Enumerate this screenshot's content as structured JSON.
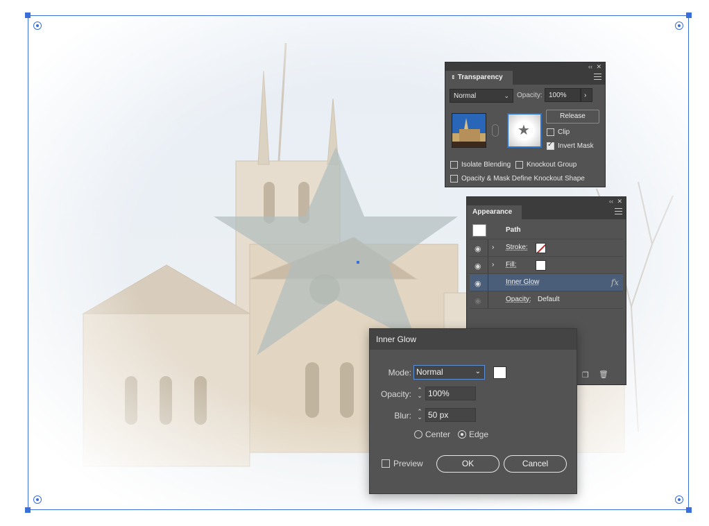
{
  "app": "Adobe Illustrator",
  "colors": {
    "selection": "#3a6ed8",
    "panel_bg": "#535353",
    "panel_header": "#3c3c3c",
    "accent": "#2f74c9",
    "selected_row": "#4a5e7a",
    "star_fill": "#8ec2ec"
  },
  "transparency": {
    "tab": "Transparency",
    "blend_mode": "Normal",
    "opacity_label": "Opacity:",
    "opacity_value": "100%",
    "release_label": "Release",
    "clip_label": "Clip",
    "clip_checked": false,
    "invert_mask_label": "Invert Mask",
    "invert_mask_checked": true,
    "isolate_label": "Isolate Blending",
    "knockout_label": "Knockout Group",
    "opacity_mask_label": "Opacity & Mask Define Knockout Shape"
  },
  "appearance": {
    "tab": "Appearance",
    "object": "Path",
    "rows": [
      {
        "label": "Stroke:",
        "icon": "stroke-none-swatch"
      },
      {
        "label": "Fill:",
        "icon": "fill-white-swatch"
      },
      {
        "label": "Inner Glow",
        "icon": "fx-icon",
        "fx": "fx"
      },
      {
        "label": "Opacity:",
        "value": "Default"
      }
    ]
  },
  "inner_glow": {
    "title": "Inner Glow",
    "mode_label": "Mode:",
    "mode_value": "Normal",
    "opacity_label": "Opacity:",
    "opacity_value": "100%",
    "blur_label": "Blur:",
    "blur_value": "50 px",
    "center_label": "Center",
    "edge_label": "Edge",
    "selected_source": "Edge",
    "preview_label": "Preview",
    "preview_checked": false,
    "ok_label": "OK",
    "cancel_label": "Cancel"
  }
}
